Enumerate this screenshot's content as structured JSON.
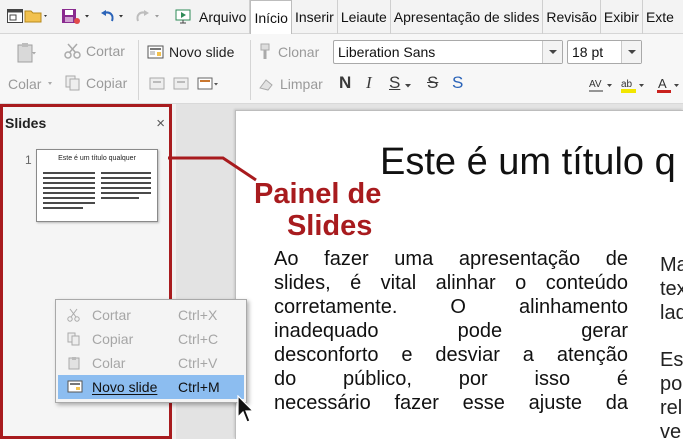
{
  "menubar": {
    "tabs": [
      "Arquivo",
      "Início",
      "Inserir",
      "Leiaute",
      "Apresentação de slides",
      "Revisão",
      "Exibir",
      "Exte"
    ],
    "active_tab": "Início"
  },
  "toolbar": {
    "cut": "Cortar",
    "paste": "Colar",
    "copy": "Copiar",
    "new_slide": "Novo slide",
    "clone": "Clonar",
    "clear": "Limpar",
    "font_name": "Liberation Sans",
    "font_size": "18 pt",
    "bold": "N",
    "italic": "I",
    "underline": "S",
    "strike": "S",
    "shadow": "S"
  },
  "colors": {
    "accent": "#a81b1e",
    "highlight": "#8cbdf0"
  },
  "panel": {
    "title": "Slides",
    "close": "×",
    "slide_number": "1",
    "thumb_title": "Este é um título qualquer"
  },
  "slide": {
    "title": "Este é um título q",
    "body_lines": [
      "Ao fazer uma apresentação de",
      "slides, é vital alinhar o conteúdo",
      "corretamente. O alinhamento",
      "inadequado pode gerar",
      "desconforto e desviar a atenção",
      "do público, por isso é",
      "necessário fazer esse ajuste da"
    ],
    "right_col_a": [
      "Ma",
      "tex",
      "lad"
    ],
    "right_col_b": [
      "Es",
      "po",
      "rel",
      "ve"
    ]
  },
  "annotation": {
    "line1": "Painel de",
    "line2": "Slides"
  },
  "context_menu": {
    "items": [
      {
        "label": "Cortar",
        "shortcut": "Ctrl+X"
      },
      {
        "label": "Copiar",
        "shortcut": "Ctrl+C"
      },
      {
        "label": "Colar",
        "shortcut": "Ctrl+V"
      },
      {
        "label": "Novo slide",
        "shortcut": "Ctrl+M"
      }
    ]
  }
}
